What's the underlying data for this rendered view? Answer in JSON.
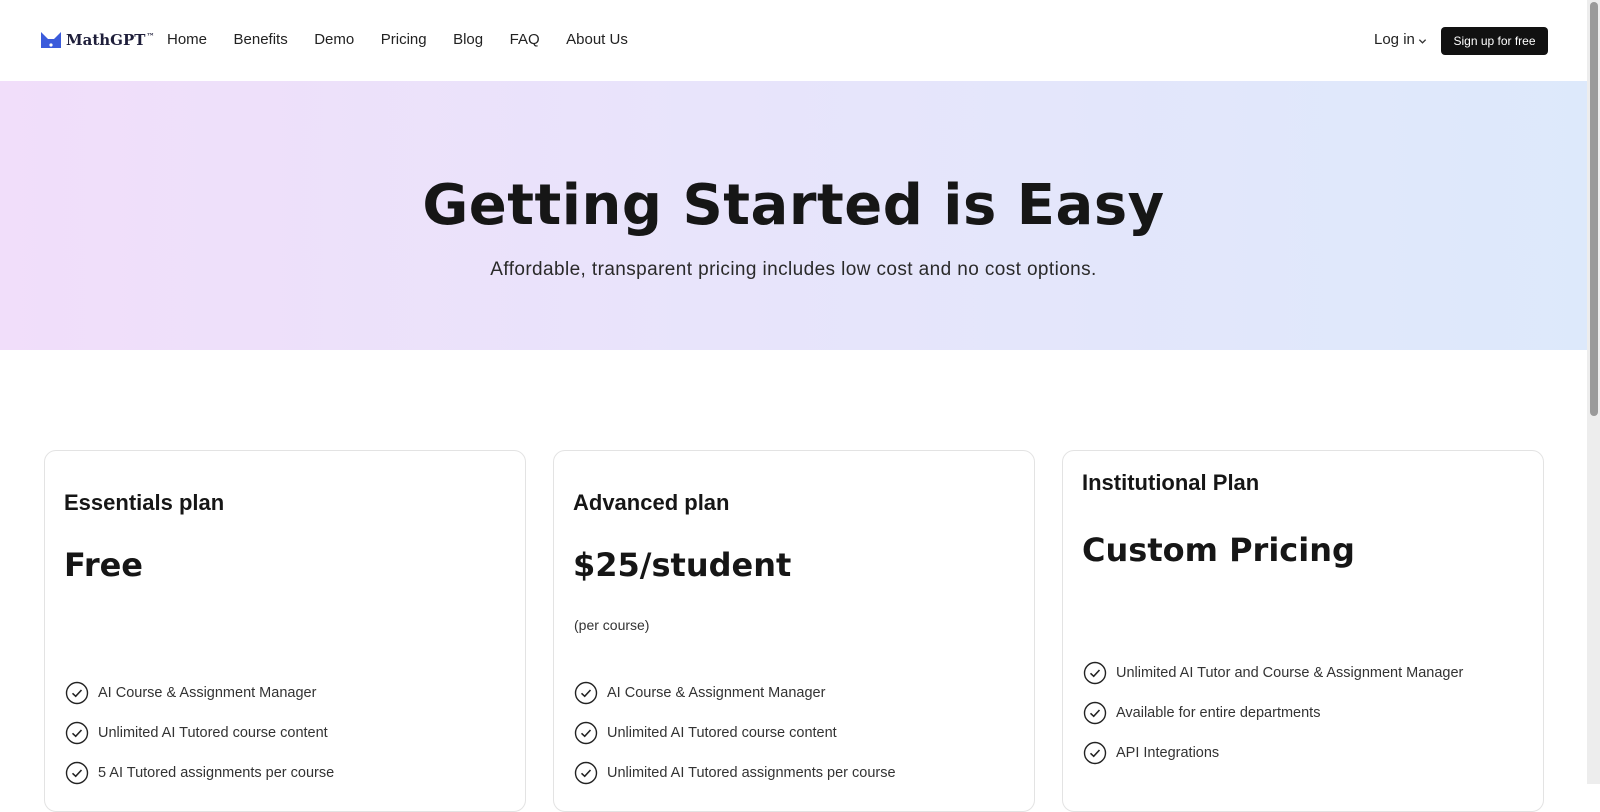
{
  "brand": {
    "name": "MathGPT",
    "tm": "™"
  },
  "nav": {
    "links": [
      "Home",
      "Benefits",
      "Demo",
      "Pricing",
      "Blog",
      "FAQ",
      "About Us"
    ],
    "login_label": "Log in",
    "signup_label": "Sign up for free"
  },
  "hero": {
    "title": "Getting Started is Easy",
    "subtitle": "Affordable, transparent pricing includes low cost and no cost options."
  },
  "plans": [
    {
      "title": "Essentials plan",
      "price": "Free",
      "note": "",
      "features": [
        "AI Course & Assignment Manager",
        "Unlimited AI Tutored course content",
        "5 AI Tutored assignments per course"
      ]
    },
    {
      "title": "Advanced plan",
      "price": "$25/student",
      "note": "(per course)",
      "features": [
        "AI Course & Assignment Manager",
        "Unlimited AI Tutored course content",
        "Unlimited AI Tutored assignments per course"
      ]
    },
    {
      "title": "Institutional Plan",
      "price": "Custom Pricing",
      "note": "",
      "features": [
        "Unlimited AI Tutor and Course & Assignment Manager",
        "Available for entire departments",
        "API Integrations"
      ]
    }
  ],
  "colors": {
    "accent": "#3b5bdb",
    "button_bg": "#111111"
  },
  "icons": {
    "logo": "mathgpt-logo-icon",
    "check": "check-circle-icon",
    "dropdown": "chevron-down-icon"
  }
}
